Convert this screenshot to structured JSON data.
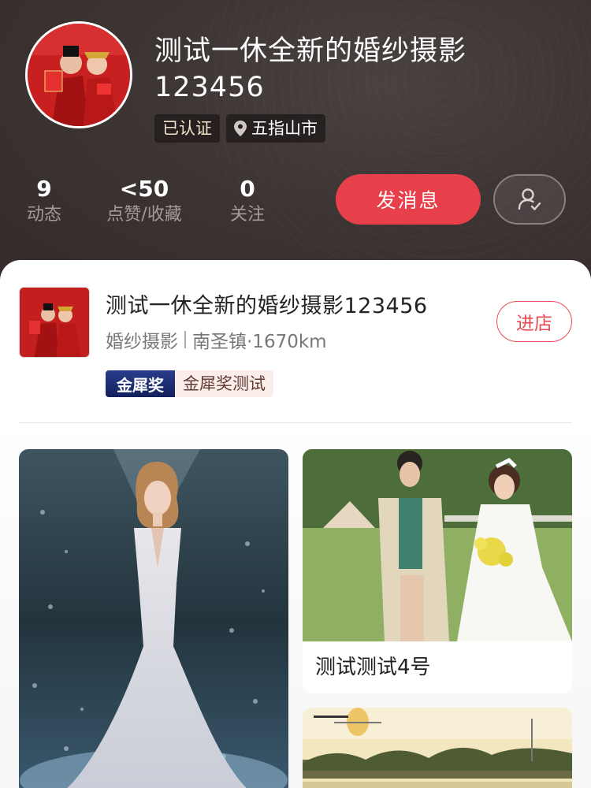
{
  "profile": {
    "title": "测试一休全新的婚纱摄影123456",
    "verified": "已认证",
    "location": "五指山市"
  },
  "stats": [
    {
      "value": "9",
      "label": "动态"
    },
    {
      "value": "<50",
      "label": "点赞/收藏"
    },
    {
      "value": "0",
      "label": "关注"
    }
  ],
  "actions": {
    "message": "发消息"
  },
  "shop": {
    "name": "测试一休全新的婚纱摄影123456",
    "category": "婚纱摄影",
    "area": "南圣镇·1670km",
    "enter": "进店",
    "award_badge": "金犀奖",
    "award_text": "金犀奖测试"
  },
  "gallery": [
    {
      "caption": ""
    },
    {
      "caption": "测试测试4号"
    },
    {
      "caption": ""
    }
  ],
  "colors": {
    "accent": "#e8404a",
    "header_bg": "#3a3231"
  }
}
